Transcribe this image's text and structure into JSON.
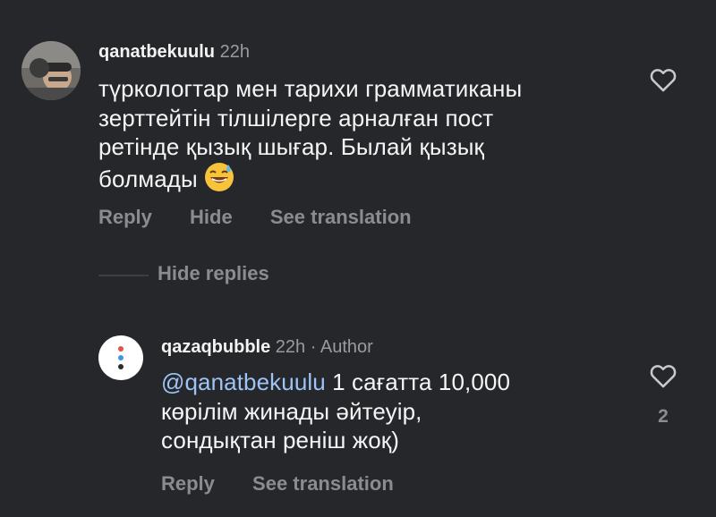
{
  "comment": {
    "username": "qanatbekuulu",
    "time": "22h",
    "lines": [
      "түркологтар мен тарихи грамматиканы",
      "зерттейтін тілшілерге арналған пост",
      "ретінде қызық шығар. Былай қызық",
      "болмады"
    ],
    "emoji": "grinning-face-with-sweat",
    "actions": {
      "reply": "Reply",
      "hide": "Hide",
      "see_translation": "See translation"
    }
  },
  "hide_replies": "Hide replies",
  "reply": {
    "username": "qazaqbubble",
    "time": "22h",
    "separator": "·",
    "author_label": "Author",
    "mention": "@qanatbekuulu",
    "line1_rest": " 1 сағатта 10,000",
    "line2": "көрілім жинады әйтеуір,",
    "line3": "сондықтан реніш жоқ)",
    "like_count": "2",
    "actions": {
      "reply": "Reply",
      "see_translation": "See translation"
    }
  },
  "colors": {
    "background": "#26272b",
    "text": "#f5f5f5",
    "muted": "#8b8c91",
    "mention": "#9ec3f5"
  },
  "icons": [
    "heart-icon",
    "avatar-photo",
    "brand-logo-dots",
    "emoji-grinning-sweat"
  ]
}
